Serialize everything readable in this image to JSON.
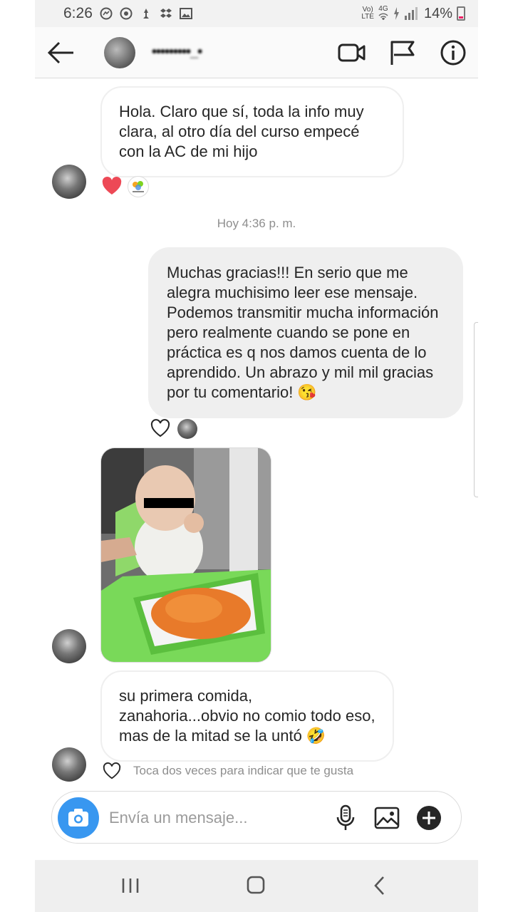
{
  "status": {
    "time": "6:26",
    "network_top": "Vo)",
    "network_bottom": "LTE",
    "signal_label": "4G",
    "battery": "14%"
  },
  "header": {
    "username": "•••••••••_•",
    "back_icon": "arrow-left-icon",
    "video_icon": "video-camera-icon",
    "flag_icon": "flag-icon",
    "info_icon": "info-icon"
  },
  "messages": [
    {
      "direction": "in",
      "text": "Hola. Claro que sí, toda la info muy clara, al otro día del curso empecé con la AC de mi hijo"
    },
    {
      "direction": "out",
      "text": "Muchas gracias!!! En serio que me alegra muchisimo leer ese mensaje. Podemos transmitir mucha información pero realmente cuando se pone en práctica es q nos damos cuenta de lo aprendido. Un abrazo y mil mil gracias por tu comentario! 😘"
    },
    {
      "direction": "in",
      "type": "photo",
      "alt": "photo"
    },
    {
      "direction": "in",
      "text": "su primera comida, zanahoria...obvio no comio todo eso, mas de la mitad se la untó 🤣"
    }
  ],
  "timestamp": "Hoy 4:36 p. m.",
  "like_hint": "Toca dos veces para indicar que te gusta",
  "composer": {
    "placeholder": "Envía un mensaje..."
  },
  "colors": {
    "accent": "#3897f0",
    "heart": "#ed4956",
    "bubble_out": "#efefef"
  }
}
